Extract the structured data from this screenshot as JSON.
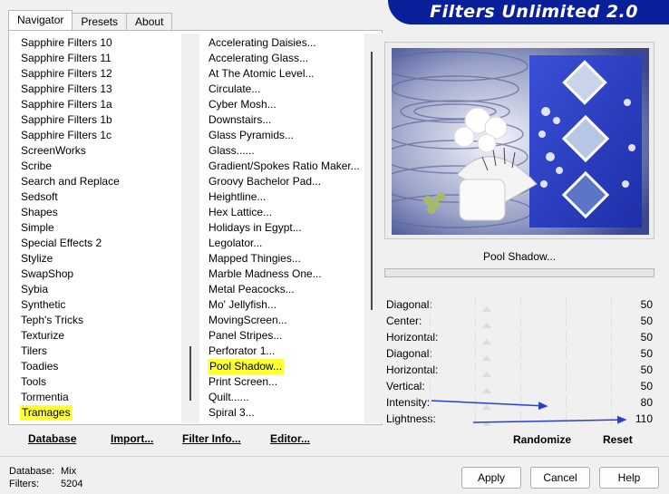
{
  "tabs": [
    {
      "label": "Navigator",
      "active": true
    },
    {
      "label": "Presets",
      "active": false
    },
    {
      "label": "About",
      "active": false
    }
  ],
  "banner": {
    "title": "Filters Unlimited 2.0"
  },
  "categories": [
    "Sapphire Filters 10",
    "Sapphire Filters 11",
    "Sapphire Filters 12",
    "Sapphire Filters 13",
    "Sapphire Filters 1a",
    "Sapphire Filters 1b",
    "Sapphire Filters 1c",
    "ScreenWorks",
    "Scribe",
    "Search and Replace",
    "Sedsoft",
    "Shapes",
    "Simple",
    "Special Effects 2",
    "Stylize",
    "SwapShop",
    "Sybia",
    "Synthetic",
    "Teph's Tricks",
    "Texturize",
    "Tilers",
    "Toadies",
    "Tools",
    "Tormentia",
    "Tramages"
  ],
  "selected_category": "Tramages",
  "filters": [
    "Accelerating Daisies...",
    "Accelerating Glass...",
    "At The Atomic Level...",
    "Circulate...",
    "Cyber Mosh...",
    "Downstairs...",
    "Glass Pyramids...",
    "Glass......",
    "Gradient/Spokes Ratio Maker...",
    "Groovy Bachelor Pad...",
    "Heightline...",
    "Hex Lattice...",
    "Holidays in Egypt...",
    "Legolator...",
    "Mapped Thingies...",
    "Marble Madness One...",
    "Metal Peacocks...",
    "Mo' Jellyfish...",
    "MovingScreen...",
    "Panel Stripes...",
    "Perforator 1...",
    "Pool Shadow...",
    "Print Screen...",
    "Quilt......",
    "Spiral 3..."
  ],
  "selected_filter": "Pool Shadow...",
  "left_buttons": {
    "database": "Database",
    "import": "Import...",
    "filter_info": "Filter Info...",
    "editor": "Editor..."
  },
  "filter_title": "Pool Shadow...",
  "params": [
    {
      "label": "Diagonal:",
      "value": "50"
    },
    {
      "label": "Center:",
      "value": "50"
    },
    {
      "label": "Horizontal:",
      "value": "50"
    },
    {
      "label": "Diagonal:",
      "value": "50"
    },
    {
      "label": "Horizontal:",
      "value": "50"
    },
    {
      "label": "Vertical:",
      "value": "50"
    },
    {
      "label": "Intensity:",
      "value": "80"
    },
    {
      "label": "Lightness:",
      "value": "110"
    }
  ],
  "right_buttons": {
    "randomize": "Randomize",
    "reset": "Reset"
  },
  "footer": {
    "database_label": "Database:",
    "database_value": "Mix",
    "filters_label": "Filters:",
    "filters_value": "5204"
  },
  "dialog_buttons": {
    "apply": "Apply",
    "cancel": "Cancel",
    "help": "Help"
  },
  "colors": {
    "banner": "#0a1f9a",
    "highlight": "#ffff33",
    "arrow": "#2a3fd0"
  }
}
